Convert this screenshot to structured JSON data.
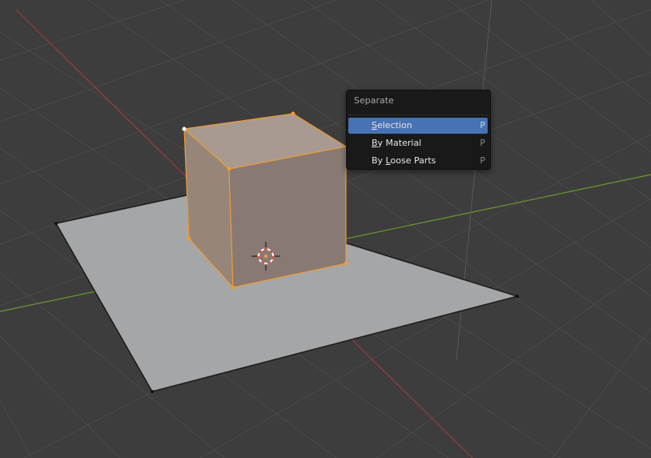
{
  "colors": {
    "background": "#3d3d3d",
    "grid": "#4a4a4a",
    "x_axis": "#9b3a43",
    "y_axis": "#6b9a2e",
    "plane": "#a5a6a7",
    "cube_front": "#887a73",
    "cube_side": "#958679",
    "cube_top": "#a89a90",
    "selection_outline": "#ef9b34",
    "menu_bg": "#191919",
    "menu_highlight": "#4772b3"
  },
  "scene": {
    "objects": [
      "plane",
      "cube",
      "3d-cursor"
    ],
    "mode": "edit",
    "selected_object": "cube"
  },
  "menu": {
    "title": "Separate",
    "items": [
      {
        "pre": "",
        "ul": "S",
        "post": "election",
        "shortcut": "P",
        "active": true
      },
      {
        "pre": "",
        "ul": "B",
        "post": "y Material",
        "shortcut": "P",
        "active": false
      },
      {
        "pre": "By ",
        "ul": "L",
        "post": "oose Parts",
        "shortcut": "P",
        "active": false
      }
    ]
  }
}
